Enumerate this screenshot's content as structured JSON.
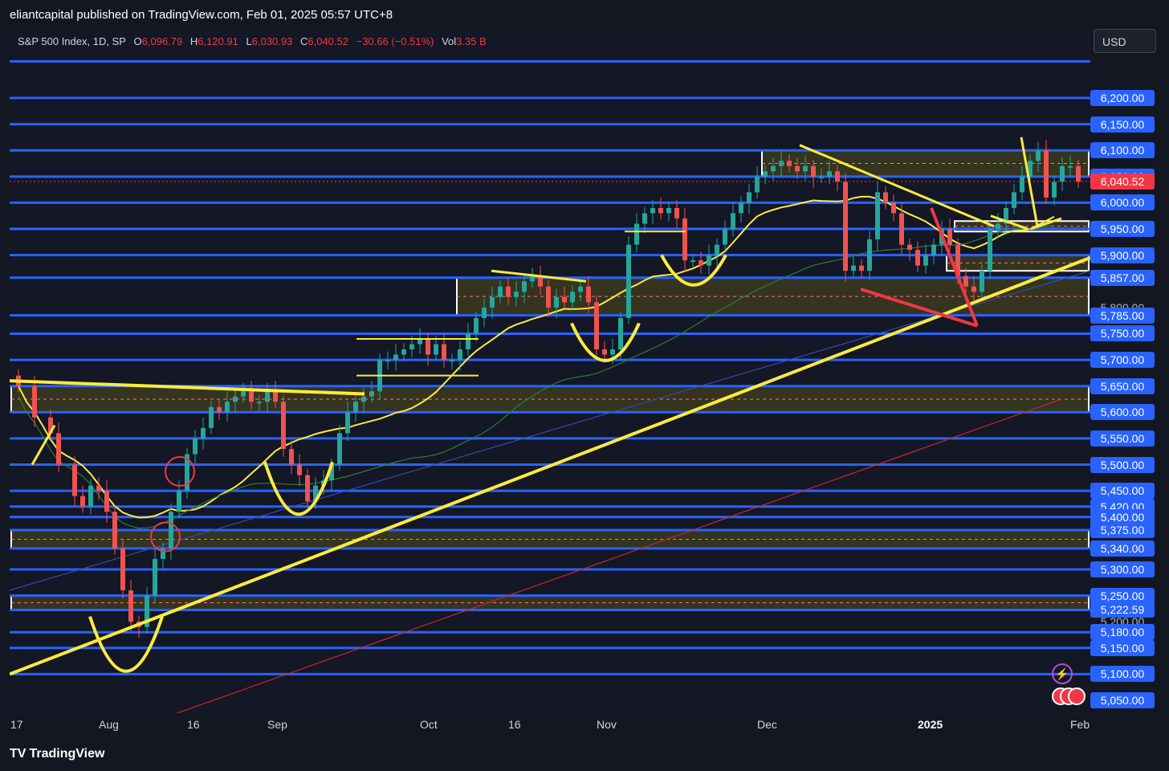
{
  "header": {
    "published_line": "eliantcapital published on TradingView.com, Feb 01, 2025 05:57 UTC+8"
  },
  "symbol_info": {
    "name": "S&P 500 Index, 1D, SP",
    "open_label": "O",
    "open": "6,096.79",
    "high_label": "H",
    "high": "6,120.91",
    "low_label": "L",
    "low": "6,030.93",
    "close_label": "C",
    "close": "6,040.52",
    "change": "−30.66 (−0.51%)",
    "vol_label": "Vol",
    "vol": "3.35 B"
  },
  "currency": "USD",
  "footer": {
    "logo_text": "TradingView"
  },
  "colors": {
    "background": "#131722",
    "level_line": "#2962ff",
    "zone_fill": "#3b3a1e",
    "zone_border": "#ffffff",
    "drawing_yellow": "#ffeb3b",
    "drawing_red": "#f23645",
    "bull": "#26a69a",
    "bear": "#ef5350"
  },
  "chart_data": {
    "type": "candlestick",
    "title": "S&P 500 Index, 1D, SP",
    "last_price": "6,040.52",
    "ylim": [
      5030,
      6300
    ],
    "price_labels": [
      {
        "text": "6,200.00",
        "value": 6200,
        "style": "blue"
      },
      {
        "text": "6,150.00",
        "value": 6150,
        "style": "blue"
      },
      {
        "text": "6,100.00",
        "value": 6100,
        "style": "blue"
      },
      {
        "text": "6,050.00",
        "value": 6050,
        "style": "blue"
      },
      {
        "text": "6,040.52",
        "value": 6040.52,
        "style": "red"
      },
      {
        "text": "6,000.00",
        "value": 6000,
        "style": "blue"
      },
      {
        "text": "5,950.00",
        "value": 5950,
        "style": "blue"
      },
      {
        "text": "5,900.00",
        "value": 5900,
        "style": "blue"
      },
      {
        "text": "5,857.00",
        "value": 5857,
        "style": "blue"
      },
      {
        "text": "5,800.00",
        "value": 5800,
        "style": "plain"
      },
      {
        "text": "5,785.00",
        "value": 5785,
        "style": "blue"
      },
      {
        "text": "5,750.00",
        "value": 5750,
        "style": "blue"
      },
      {
        "text": "5,700.00",
        "value": 5700,
        "style": "blue"
      },
      {
        "text": "5,650.00",
        "value": 5650,
        "style": "blue"
      },
      {
        "text": "5,600.00",
        "value": 5600,
        "style": "blue"
      },
      {
        "text": "5,550.00",
        "value": 5550,
        "style": "blue"
      },
      {
        "text": "5,500.00",
        "value": 5500,
        "style": "blue"
      },
      {
        "text": "5,450.00",
        "value": 5450,
        "style": "blue"
      },
      {
        "text": "5,420.00",
        "value": 5420,
        "style": "blue"
      },
      {
        "text": "5,400.00",
        "value": 5400,
        "style": "blue"
      },
      {
        "text": "5,375.00",
        "value": 5375,
        "style": "blue"
      },
      {
        "text": "5,340.00",
        "value": 5340,
        "style": "blue"
      },
      {
        "text": "5,300.00",
        "value": 5300,
        "style": "blue"
      },
      {
        "text": "5,250.00",
        "value": 5250,
        "style": "blue"
      },
      {
        "text": "5,222.59",
        "value": 5222.59,
        "style": "blue"
      },
      {
        "text": "5,200.00",
        "value": 5200,
        "style": "plain"
      },
      {
        "text": "5,180.00",
        "value": 5180,
        "style": "blue"
      },
      {
        "text": "5,150.00",
        "value": 5150,
        "style": "blue"
      },
      {
        "text": "5,100.00",
        "value": 5100,
        "style": "blue"
      },
      {
        "text": "5,050.00",
        "value": 5050,
        "style": "blue"
      }
    ],
    "horizontal_levels": [
      6270,
      6200,
      6150,
      6100,
      6050,
      6000,
      5950,
      5900,
      5857,
      5785,
      5750,
      5700,
      5650,
      5600,
      5550,
      5500,
      5450,
      5420,
      5400,
      5375,
      5340,
      5300,
      5250,
      5222.59,
      5180,
      5150,
      5100
    ],
    "x_ticks": [
      {
        "label": "17",
        "bold": false,
        "index": 0
      },
      {
        "label": "Aug",
        "bold": false,
        "index": 11
      },
      {
        "label": "16",
        "bold": false,
        "index": 22
      },
      {
        "label": "Sep",
        "bold": false,
        "index": 32
      },
      {
        "label": "Oct",
        "bold": false,
        "index": 51
      },
      {
        "label": "16",
        "bold": false,
        "index": 62
      },
      {
        "label": "Nov",
        "bold": false,
        "index": 73
      },
      {
        "label": "Dec",
        "bold": false,
        "index": 93
      },
      {
        "label": "2025",
        "bold": true,
        "index": 113
      },
      {
        "label": "Feb",
        "bold": false,
        "index": 132
      }
    ],
    "candles_count": 133,
    "close_path": [
      [
        0,
        5650
      ],
      [
        2,
        5590
      ],
      [
        4,
        5560
      ],
      [
        5,
        5500
      ],
      [
        7,
        5440
      ],
      [
        8,
        5420
      ],
      [
        9,
        5460
      ],
      [
        10,
        5450
      ],
      [
        11,
        5410
      ],
      [
        12,
        5340
      ],
      [
        13,
        5260
      ],
      [
        14,
        5200
      ],
      [
        15,
        5190
      ],
      [
        16,
        5250
      ],
      [
        17,
        5320
      ],
      [
        18,
        5340
      ],
      [
        19,
        5410
      ],
      [
        20,
        5450
      ],
      [
        21,
        5520
      ],
      [
        22,
        5550
      ],
      [
        23,
        5570
      ],
      [
        24,
        5610
      ],
      [
        25,
        5600
      ],
      [
        26,
        5620
      ],
      [
        27,
        5630
      ],
      [
        28,
        5640
      ],
      [
        29,
        5620
      ],
      [
        30,
        5620
      ],
      [
        31,
        5640
      ],
      [
        32,
        5620
      ],
      [
        33,
        5530
      ],
      [
        34,
        5500
      ],
      [
        35,
        5480
      ],
      [
        36,
        5430
      ],
      [
        37,
        5460
      ],
      [
        38,
        5470
      ],
      [
        39,
        5500
      ],
      [
        40,
        5560
      ],
      [
        41,
        5600
      ],
      [
        42,
        5620
      ],
      [
        43,
        5630
      ],
      [
        44,
        5640
      ],
      [
        45,
        5700
      ],
      [
        46,
        5700
      ],
      [
        47,
        5710
      ],
      [
        48,
        5720
      ],
      [
        49,
        5730
      ],
      [
        50,
        5740
      ],
      [
        51,
        5710
      ],
      [
        52,
        5730
      ],
      [
        53,
        5700
      ],
      [
        54,
        5700
      ],
      [
        55,
        5720
      ],
      [
        56,
        5750
      ],
      [
        57,
        5780
      ],
      [
        58,
        5800
      ],
      [
        59,
        5820
      ],
      [
        60,
        5840
      ],
      [
        61,
        5820
      ],
      [
        62,
        5830
      ],
      [
        63,
        5850
      ],
      [
        64,
        5860
      ],
      [
        65,
        5840
      ],
      [
        66,
        5800
      ],
      [
        67,
        5820
      ],
      [
        68,
        5810
      ],
      [
        69,
        5830
      ],
      [
        70,
        5840
      ],
      [
        71,
        5810
      ],
      [
        72,
        5720
      ],
      [
        73,
        5710
      ],
      [
        74,
        5720
      ],
      [
        75,
        5780
      ],
      [
        76,
        5920
      ],
      [
        77,
        5960
      ],
      [
        78,
        5980
      ],
      [
        79,
        5990
      ],
      [
        80,
        5980
      ],
      [
        81,
        5990
      ],
      [
        82,
        5970
      ],
      [
        83,
        5890
      ],
      [
        84,
        5890
      ],
      [
        85,
        5880
      ],
      [
        86,
        5900
      ],
      [
        87,
        5920
      ],
      [
        88,
        5950
      ],
      [
        89,
        5980
      ],
      [
        90,
        6000
      ],
      [
        91,
        6020
      ],
      [
        92,
        6050
      ],
      [
        93,
        6060
      ],
      [
        94,
        6070
      ],
      [
        95,
        6080
      ],
      [
        96,
        6070
      ],
      [
        97,
        6060
      ],
      [
        98,
        6070
      ],
      [
        99,
        6050
      ],
      [
        100,
        6050
      ],
      [
        101,
        6060
      ],
      [
        102,
        6040
      ],
      [
        103,
        5870
      ],
      [
        104,
        5880
      ],
      [
        105,
        5870
      ],
      [
        106,
        5930
      ],
      [
        107,
        6020
      ],
      [
        108,
        6000
      ],
      [
        109,
        5980
      ],
      [
        110,
        5920
      ],
      [
        111,
        5910
      ],
      [
        112,
        5880
      ],
      [
        113,
        5900
      ],
      [
        114,
        5920
      ],
      [
        115,
        5950
      ],
      [
        116,
        5920
      ],
      [
        117,
        5860
      ],
      [
        118,
        5840
      ],
      [
        119,
        5830
      ],
      [
        120,
        5870
      ],
      [
        121,
        5950
      ],
      [
        122,
        5960
      ],
      [
        123,
        5990
      ],
      [
        124,
        6020
      ],
      [
        125,
        6050
      ],
      [
        126,
        6080
      ],
      [
        127,
        6100
      ],
      [
        128,
        6010
      ],
      [
        129,
        6040
      ],
      [
        130,
        6070
      ],
      [
        131,
        6070
      ],
      [
        132,
        6040
      ]
    ],
    "zones": [
      {
        "from": 5650,
        "to": 5600,
        "start": 0,
        "end": 133
      },
      {
        "from": 5375,
        "to": 5340,
        "start": 0,
        "end": 133
      },
      {
        "from": 5250,
        "to": 5222.59,
        "start": 0,
        "end": 133
      },
      {
        "from": 5857,
        "to": 5785,
        "start": 55,
        "end": 133
      },
      {
        "from": 6100,
        "to": 6050,
        "start": 93,
        "end": 133
      },
      {
        "from": 5965,
        "to": 5945,
        "start": 117,
        "end": 133
      },
      {
        "from": 5900,
        "to": 5870,
        "start": 116,
        "end": 133
      }
    ]
  }
}
